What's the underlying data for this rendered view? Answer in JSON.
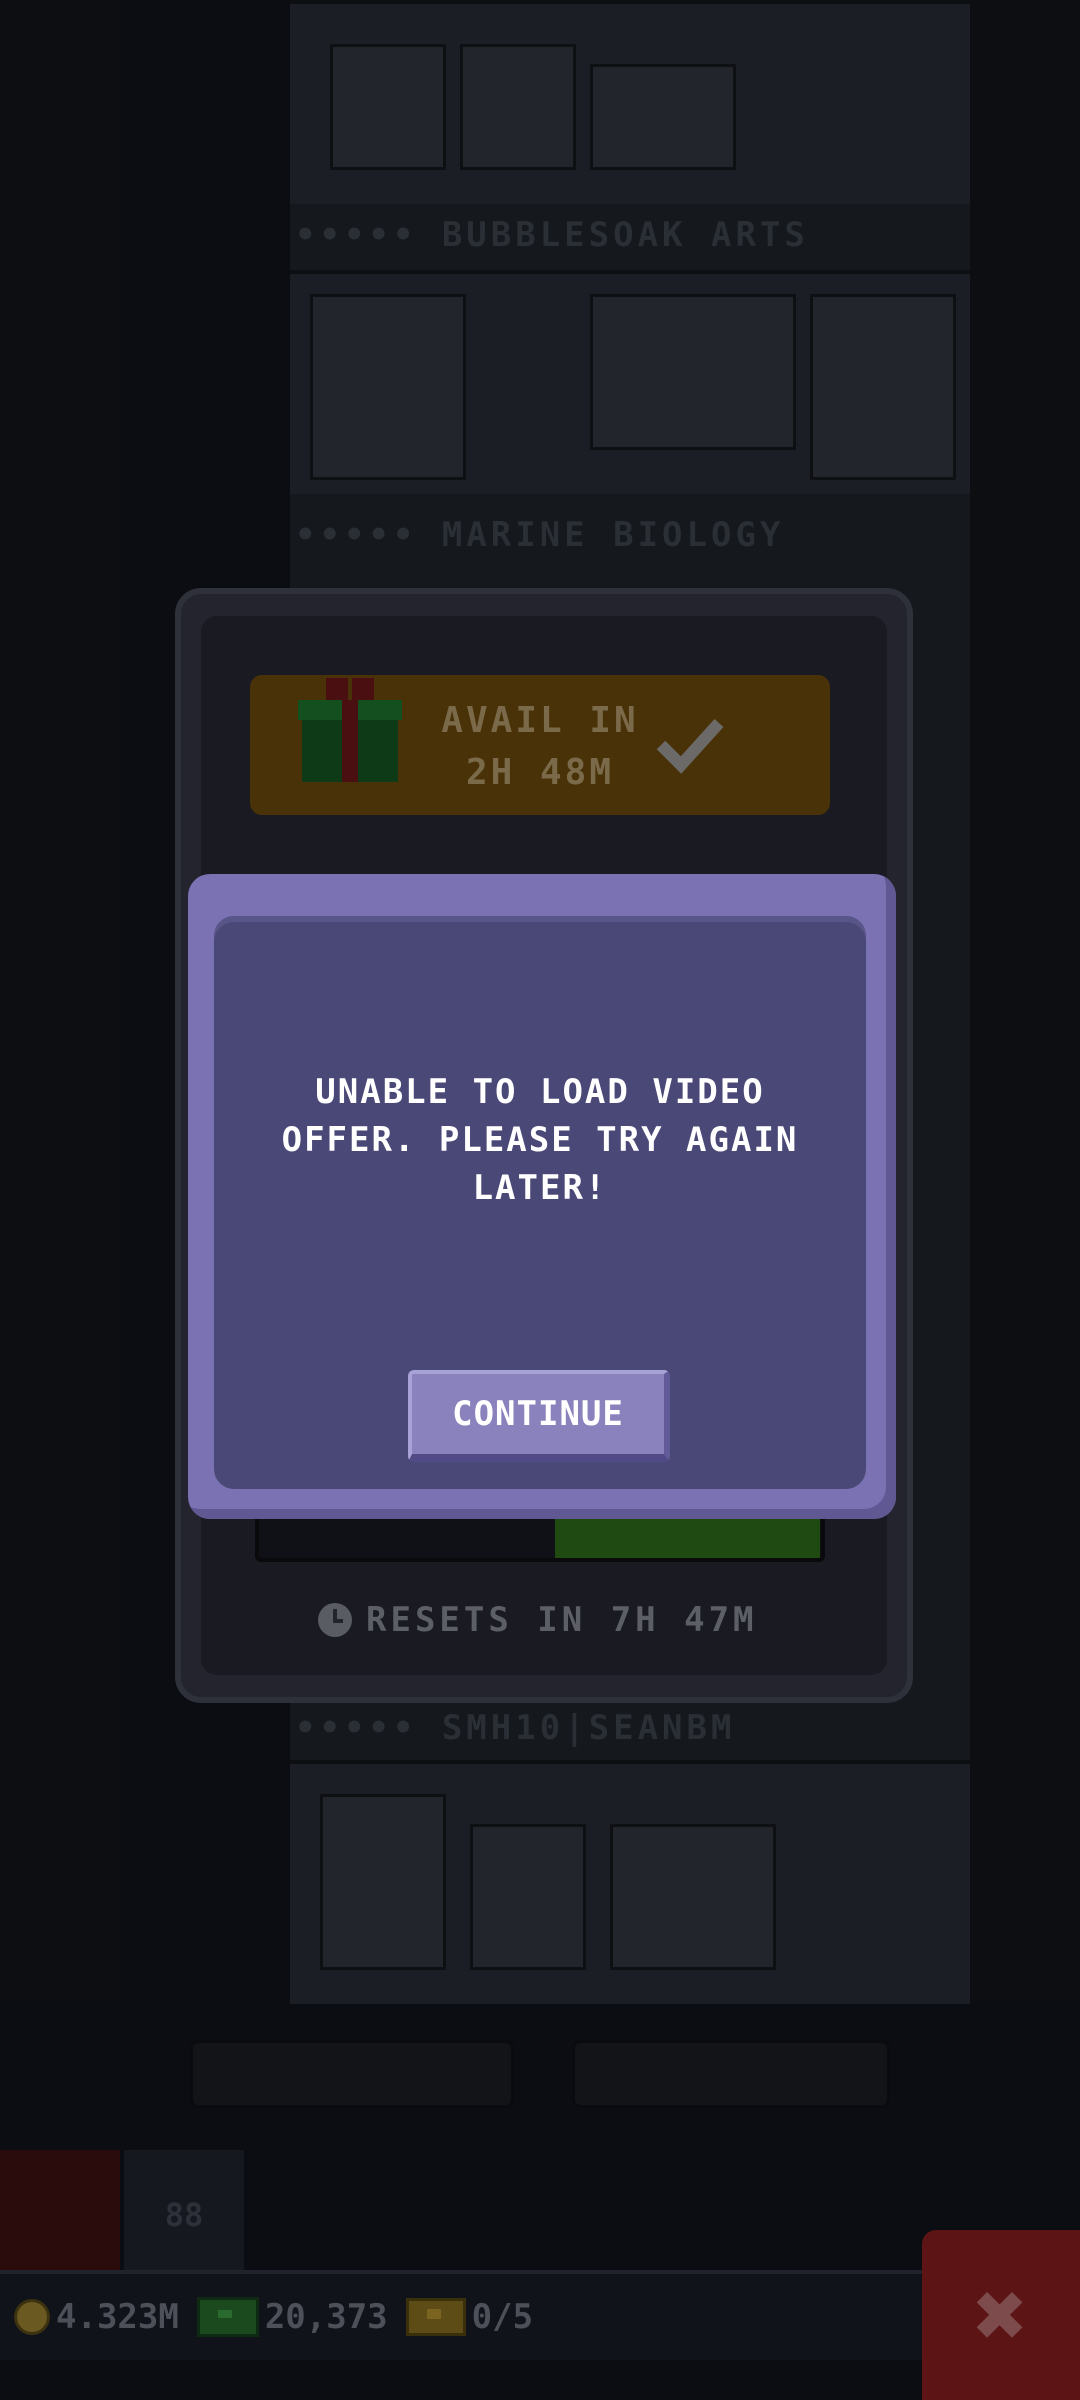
{
  "background": {
    "floor_labels": [
      "••••• BUBBLESOAK ARTS",
      "••••• MARINE BIOLOGY",
      "••••• SMH10|SEANBM"
    ],
    "left_button_label": "88"
  },
  "daily_panel": {
    "gift_status": "AVAIL IN\n2H 48M",
    "resets_text": "RESETS IN 7H 47M"
  },
  "dialog": {
    "message": "UNABLE TO LOAD VIDEO\nOFFER. PLEASE TRY AGAIN\nLATER!",
    "continue_label": "CONTINUE"
  },
  "status_bar": {
    "coins": "4.323M",
    "bux": "20,373",
    "tickets": "0/5"
  },
  "colors": {
    "dialog_frame": "#7b72b3",
    "dialog_body": "#4a4876",
    "button": "#8a82bd",
    "close_button": "#5c1414"
  }
}
